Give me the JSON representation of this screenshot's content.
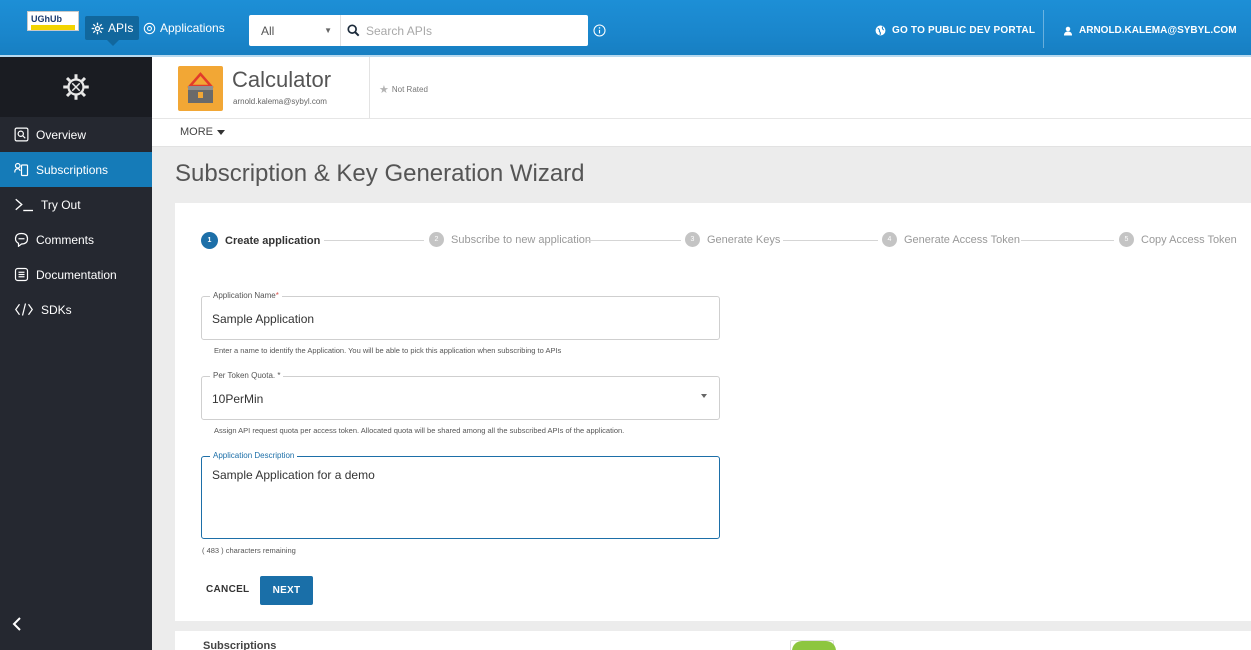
{
  "topbar": {
    "logo_text": "UGhUb",
    "apis_label": "APIs",
    "applications_label": "Applications",
    "search_scope": "All",
    "search_placeholder": "Search APIs",
    "public_portal_label": "GO TO PUBLIC DEV PORTAL",
    "user_label": "ARNOLD.KALEMA@SYBYL.COM"
  },
  "sidebar": {
    "items": [
      {
        "label": "Overview",
        "icon": "overview-icon",
        "active": false
      },
      {
        "label": "Subscriptions",
        "icon": "subscriptions-icon",
        "active": true
      },
      {
        "label": "Try Out",
        "icon": "terminal-icon",
        "active": false
      },
      {
        "label": "Comments",
        "icon": "comment-icon",
        "active": false
      },
      {
        "label": "Documentation",
        "icon": "document-icon",
        "active": false
      },
      {
        "label": "SDKs",
        "icon": "code-icon",
        "active": false
      }
    ]
  },
  "api": {
    "name": "Calculator",
    "owner": "arnold.kalema@sybyl.com",
    "rating": "Not Rated"
  },
  "more_label": "MORE",
  "page_title": "Subscription & Key Generation Wizard",
  "steps": [
    {
      "num": "1",
      "label": "Create application",
      "active": true
    },
    {
      "num": "2",
      "label": "Subscribe to new application",
      "active": false
    },
    {
      "num": "3",
      "label": "Generate Keys",
      "active": false
    },
    {
      "num": "4",
      "label": "Generate Access Token",
      "active": false
    },
    {
      "num": "5",
      "label": "Copy Access Token",
      "active": false
    }
  ],
  "form": {
    "app_name_label": "Application Name",
    "app_name_value": "Sample Application",
    "app_name_help": "Enter a name to identify the Application. You will be able to pick this application when subscribing to APIs",
    "quota_label": "Per Token Quota.",
    "quota_value": "10PerMin",
    "quota_help": "Assign API request quota per access token. Allocated quota will be shared among all the subscribed APIs of the application.",
    "description_label": "Application Description",
    "description_value": "Sample Application for a demo",
    "chars_remaining": "( 483 ) characters remaining",
    "required_mark": "*"
  },
  "buttons": {
    "cancel": "CANCEL",
    "next": "NEXT"
  },
  "below": {
    "subscriptions_label": "Subscriptions"
  },
  "colors": {
    "topbar": "#1a86cc",
    "sidebar": "#252830",
    "active": "#157bb8",
    "primary_button": "#1a6fa8"
  }
}
